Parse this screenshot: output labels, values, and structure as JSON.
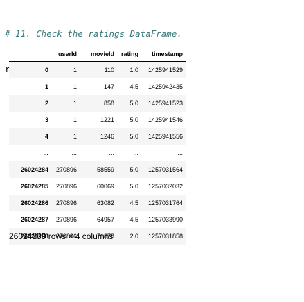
{
  "code": {
    "comment": "# 11. Check the ratings DataFrame.",
    "line": "ratings"
  },
  "table": {
    "columns": [
      "userId",
      "movieId",
      "rating",
      "timestamp"
    ],
    "rows": [
      {
        "index": "0",
        "cells": [
          "1",
          "110",
          "1.0",
          "1425941529"
        ]
      },
      {
        "index": "1",
        "cells": [
          "1",
          "147",
          "4.5",
          "1425942435"
        ]
      },
      {
        "index": "2",
        "cells": [
          "1",
          "858",
          "5.0",
          "1425941523"
        ]
      },
      {
        "index": "3",
        "cells": [
          "1",
          "1221",
          "5.0",
          "1425941546"
        ]
      },
      {
        "index": "4",
        "cells": [
          "1",
          "1246",
          "5.0",
          "1425941556"
        ]
      },
      {
        "index": "...",
        "cells": [
          "...",
          "...",
          "...",
          "..."
        ]
      },
      {
        "index": "26024284",
        "cells": [
          "270896",
          "58559",
          "5.0",
          "1257031564"
        ]
      },
      {
        "index": "26024285",
        "cells": [
          "270896",
          "60069",
          "5.0",
          "1257032032"
        ]
      },
      {
        "index": "26024286",
        "cells": [
          "270896",
          "63082",
          "4.5",
          "1257031764"
        ]
      },
      {
        "index": "26024287",
        "cells": [
          "270896",
          "64957",
          "4.5",
          "1257033990"
        ]
      },
      {
        "index": "26024288",
        "cells": [
          "270896",
          "71878",
          "2.0",
          "1257031858"
        ]
      }
    ]
  },
  "summary": "26024289 rows × 4 columns"
}
